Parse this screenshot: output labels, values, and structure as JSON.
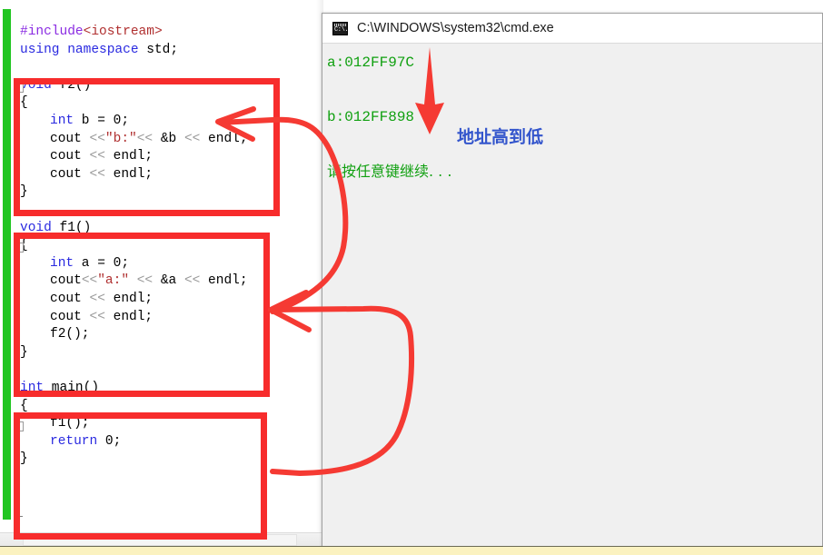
{
  "editor": {
    "name": "code-editor",
    "language": "cpp",
    "lines": [
      {
        "indent": 0,
        "segments": [
          {
            "t": "#include",
            "c": "pp"
          },
          {
            "t": "<iostream>",
            "c": "inc"
          }
        ]
      },
      {
        "indent": 0,
        "segments": [
          {
            "t": "using namespace",
            "c": "kw"
          },
          {
            "t": " std;",
            "c": ""
          }
        ]
      },
      {
        "indent": 0,
        "segments": []
      },
      {
        "indent": 0,
        "segments": [
          {
            "t": "void",
            "c": "kw"
          },
          {
            "t": " f2()",
            "c": ""
          }
        ]
      },
      {
        "indent": 0,
        "segments": [
          {
            "t": "{",
            "c": ""
          }
        ]
      },
      {
        "indent": 1,
        "segments": [
          {
            "t": "int",
            "c": "kw"
          },
          {
            "t": " b = 0;",
            "c": ""
          }
        ]
      },
      {
        "indent": 1,
        "segments": [
          {
            "t": "cout ",
            "c": ""
          },
          {
            "t": "<<",
            "c": "opg"
          },
          {
            "t": "\"b:\"",
            "c": "str"
          },
          {
            "t": "<<",
            "c": "opg"
          },
          {
            "t": " &b ",
            "c": ""
          },
          {
            "t": "<<",
            "c": "opg"
          },
          {
            "t": " endl;",
            "c": ""
          }
        ]
      },
      {
        "indent": 1,
        "segments": [
          {
            "t": "cout ",
            "c": ""
          },
          {
            "t": "<<",
            "c": "opg"
          },
          {
            "t": " endl;",
            "c": ""
          }
        ]
      },
      {
        "indent": 1,
        "segments": [
          {
            "t": "cout ",
            "c": ""
          },
          {
            "t": "<<",
            "c": "opg"
          },
          {
            "t": " endl;",
            "c": ""
          }
        ]
      },
      {
        "indent": 0,
        "segments": [
          {
            "t": "}",
            "c": ""
          }
        ]
      },
      {
        "indent": 0,
        "segments": []
      },
      {
        "indent": 0,
        "segments": [
          {
            "t": "void",
            "c": "kw"
          },
          {
            "t": " f1()",
            "c": ""
          }
        ]
      },
      {
        "indent": 0,
        "segments": [
          {
            "t": "{",
            "c": ""
          }
        ]
      },
      {
        "indent": 1,
        "segments": [
          {
            "t": "int",
            "c": "kw"
          },
          {
            "t": " a = 0;",
            "c": ""
          }
        ]
      },
      {
        "indent": 1,
        "segments": [
          {
            "t": "cout",
            "c": ""
          },
          {
            "t": "<<",
            "c": "opg"
          },
          {
            "t": "\"a:\"",
            "c": "str"
          },
          {
            "t": " ",
            "c": ""
          },
          {
            "t": "<<",
            "c": "opg"
          },
          {
            "t": " &a ",
            "c": ""
          },
          {
            "t": "<<",
            "c": "opg"
          },
          {
            "t": " endl;",
            "c": ""
          }
        ]
      },
      {
        "indent": 1,
        "segments": [
          {
            "t": "cout ",
            "c": ""
          },
          {
            "t": "<<",
            "c": "opg"
          },
          {
            "t": " endl;",
            "c": ""
          }
        ]
      },
      {
        "indent": 1,
        "segments": [
          {
            "t": "cout ",
            "c": ""
          },
          {
            "t": "<<",
            "c": "opg"
          },
          {
            "t": " endl;",
            "c": ""
          }
        ]
      },
      {
        "indent": 1,
        "segments": [
          {
            "t": "f2();",
            "c": ""
          }
        ]
      },
      {
        "indent": 0,
        "segments": [
          {
            "t": "}",
            "c": ""
          }
        ]
      },
      {
        "indent": 0,
        "segments": []
      },
      {
        "indent": 0,
        "segments": [
          {
            "t": "int",
            "c": "kw"
          },
          {
            "t": " main()",
            "c": ""
          }
        ]
      },
      {
        "indent": 0,
        "segments": [
          {
            "t": "{",
            "c": ""
          }
        ]
      },
      {
        "indent": 1,
        "segments": [
          {
            "t": "f1();",
            "c": ""
          }
        ]
      },
      {
        "indent": 1,
        "segments": [
          {
            "t": "return",
            "c": "kw"
          },
          {
            "t": " 0;",
            "c": ""
          }
        ]
      },
      {
        "indent": 0,
        "segments": [
          {
            "t": "}",
            "c": ""
          }
        ]
      }
    ],
    "fold_markers": [
      "-",
      "-",
      "-"
    ],
    "change_bar_color": "#21c521"
  },
  "annotations": {
    "box_color": "#f72c2c",
    "boxes": [
      {
        "label": "f2-function-highlight"
      },
      {
        "label": "f1-function-highlight"
      },
      {
        "label": "main-function-highlight"
      }
    ],
    "arrows": [
      {
        "label": "arrow-f2-from-console"
      },
      {
        "label": "arrow-f1-from-main"
      },
      {
        "label": "arrow-address-high-to-low"
      }
    ]
  },
  "console": {
    "title": "C:\\WINDOWS\\system32\\cmd.exe",
    "icon": "cmd-icon",
    "output": [
      {
        "text": "a:012FF97C",
        "color": "#10a010"
      },
      {
        "text": "b:012FF898",
        "color": "#10a010"
      },
      {
        "text": "请按任意键继续. . .",
        "color": "#10a010"
      }
    ],
    "note": {
      "text": "地址高到低",
      "color": "#3355cc"
    }
  }
}
